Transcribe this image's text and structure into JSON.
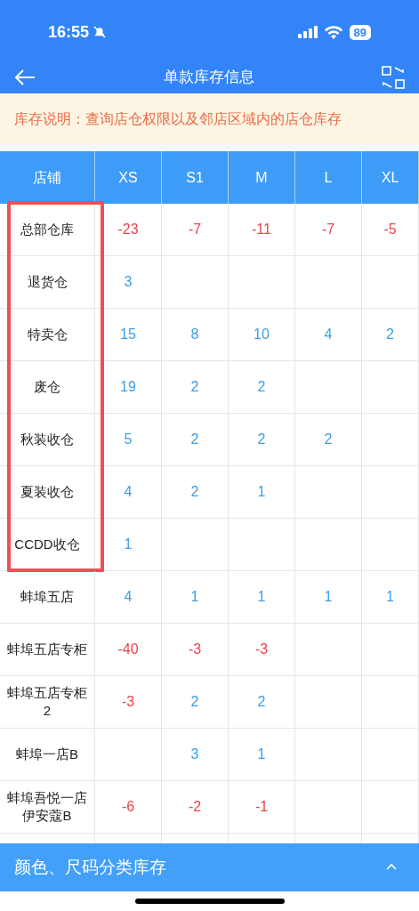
{
  "status_bar": {
    "time": "16:55",
    "battery": "89"
  },
  "nav": {
    "title": "单款库存信息"
  },
  "notice": "库存说明：查询店仓权限以及邻店区域内的店仓库存",
  "table": {
    "columns": [
      "店铺",
      "XS",
      "S1",
      "M",
      "L",
      "XL"
    ],
    "rows": [
      {
        "highlighted": true,
        "cells": [
          {
            "text": "总部仓库"
          },
          {
            "text": "-23",
            "color": "#e8434b"
          },
          {
            "text": "-7",
            "color": "#e8434b"
          },
          {
            "text": "-11",
            "color": "#e8434b"
          },
          {
            "text": "-7",
            "color": "#e8434b"
          },
          {
            "text": "-5",
            "color": "#e8434b"
          }
        ]
      },
      {
        "highlighted": true,
        "cells": [
          {
            "text": "退货仓"
          },
          {
            "text": "3",
            "color": "#3a9ee8"
          },
          {},
          {},
          {},
          {}
        ]
      },
      {
        "highlighted": true,
        "cells": [
          {
            "text": "特卖仓"
          },
          {
            "text": "15",
            "color": "#3a9ee8"
          },
          {
            "text": "8",
            "color": "#3a9ee8"
          },
          {
            "text": "10",
            "color": "#3a9ee8"
          },
          {
            "text": "4",
            "color": "#3a9ee8"
          },
          {
            "text": "2",
            "color": "#3a9ee8"
          }
        ]
      },
      {
        "highlighted": true,
        "cells": [
          {
            "text": "废仓"
          },
          {
            "text": "19",
            "color": "#3a9ee8"
          },
          {
            "text": "2",
            "color": "#3a9ee8"
          },
          {
            "text": "2",
            "color": "#3a9ee8"
          },
          {},
          {}
        ]
      },
      {
        "highlighted": true,
        "cells": [
          {
            "text": "秋装收仓"
          },
          {
            "text": "5",
            "color": "#3a9ee8"
          },
          {
            "text": "2",
            "color": "#3a9ee8"
          },
          {
            "text": "2",
            "color": "#3a9ee8"
          },
          {
            "text": "2",
            "color": "#3a9ee8"
          },
          {}
        ]
      },
      {
        "highlighted": true,
        "cells": [
          {
            "text": "夏装收仓"
          },
          {
            "text": "4",
            "color": "#3a9ee8"
          },
          {
            "text": "2",
            "color": "#3a9ee8"
          },
          {
            "text": "1",
            "color": "#3a9ee8"
          },
          {},
          {}
        ]
      },
      {
        "highlighted": true,
        "cells": [
          {
            "text": "CCDD收仓"
          },
          {
            "text": "1",
            "color": "#3a9ee8"
          },
          {},
          {},
          {},
          {}
        ]
      },
      {
        "highlighted": false,
        "cells": [
          {
            "text": "蚌埠五店"
          },
          {
            "text": "4",
            "color": "#3a9ee8"
          },
          {
            "text": "1",
            "color": "#3a9ee8"
          },
          {
            "text": "1",
            "color": "#3a9ee8"
          },
          {
            "text": "1",
            "color": "#3a9ee8"
          },
          {
            "text": "1",
            "color": "#3a9ee8"
          }
        ]
      },
      {
        "highlighted": false,
        "cells": [
          {
            "text": "蚌埠五店专柜"
          },
          {
            "text": "-40",
            "color": "#e8434b"
          },
          {
            "text": "-3",
            "color": "#e8434b"
          },
          {
            "text": "-3",
            "color": "#e8434b"
          },
          {},
          {}
        ]
      },
      {
        "highlighted": false,
        "cells": [
          {
            "text": "蚌埠五店专柜2"
          },
          {
            "text": "-3",
            "color": "#e8434b"
          },
          {
            "text": "2",
            "color": "#3a9ee8"
          },
          {
            "text": "2",
            "color": "#3a9ee8"
          },
          {},
          {}
        ]
      },
      {
        "highlighted": false,
        "cells": [
          {
            "text": "蚌埠一店B"
          },
          {},
          {
            "text": "3",
            "color": "#3a9ee8"
          },
          {
            "text": "1",
            "color": "#3a9ee8"
          },
          {},
          {}
        ]
      },
      {
        "highlighted": false,
        "cells": [
          {
            "text": "蚌埠吾悦一店伊安蔻B"
          },
          {
            "text": "-6",
            "color": "#e8434b"
          },
          {
            "text": "-2",
            "color": "#e8434b"
          },
          {
            "text": "-1",
            "color": "#e8434b"
          },
          {},
          {}
        ]
      }
    ]
  },
  "bottom_panel": {
    "title": "颜色、尺码分类库存",
    "expanded": false
  }
}
